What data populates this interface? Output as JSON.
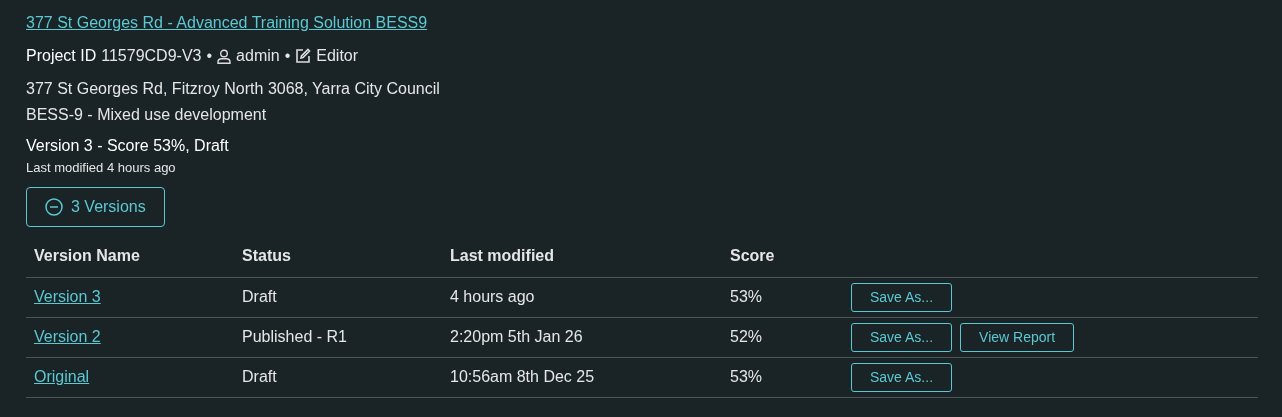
{
  "project_title": "377 St Georges Rd - Advanced Training Solution BESS9",
  "meta": {
    "label": "Project ID",
    "id": "11579CD9-V3",
    "separator_1": "•",
    "user": "admin",
    "separator_2": "•",
    "role": "Editor"
  },
  "address": "377 St Georges Rd, Fitzroy North 3068, Yarra City Council",
  "description": "BESS-9 - Mixed use development",
  "current_version": "Version 3 - Score 53%, Draft",
  "last_modified": "Last modified 4 hours ago",
  "versions_toggle": {
    "label": "3 Versions",
    "expanded": true
  },
  "table": {
    "columns": [
      "Version Name",
      "Status",
      "Last modified",
      "Score"
    ],
    "rows": [
      {
        "name": "Version 3",
        "status": "Draft",
        "modified": "4 hours ago",
        "score": "53%",
        "actions": [
          "Save As..."
        ]
      },
      {
        "name": "Version 2",
        "status": "Published - R1",
        "modified": "2:20pm 5th Jan 26",
        "score": "52%",
        "actions": [
          "Save As...",
          "View Report"
        ]
      },
      {
        "name": "Original",
        "status": "Draft",
        "modified": "10:56am 8th Dec 25",
        "score": "53%",
        "actions": [
          "Save As..."
        ]
      }
    ]
  }
}
